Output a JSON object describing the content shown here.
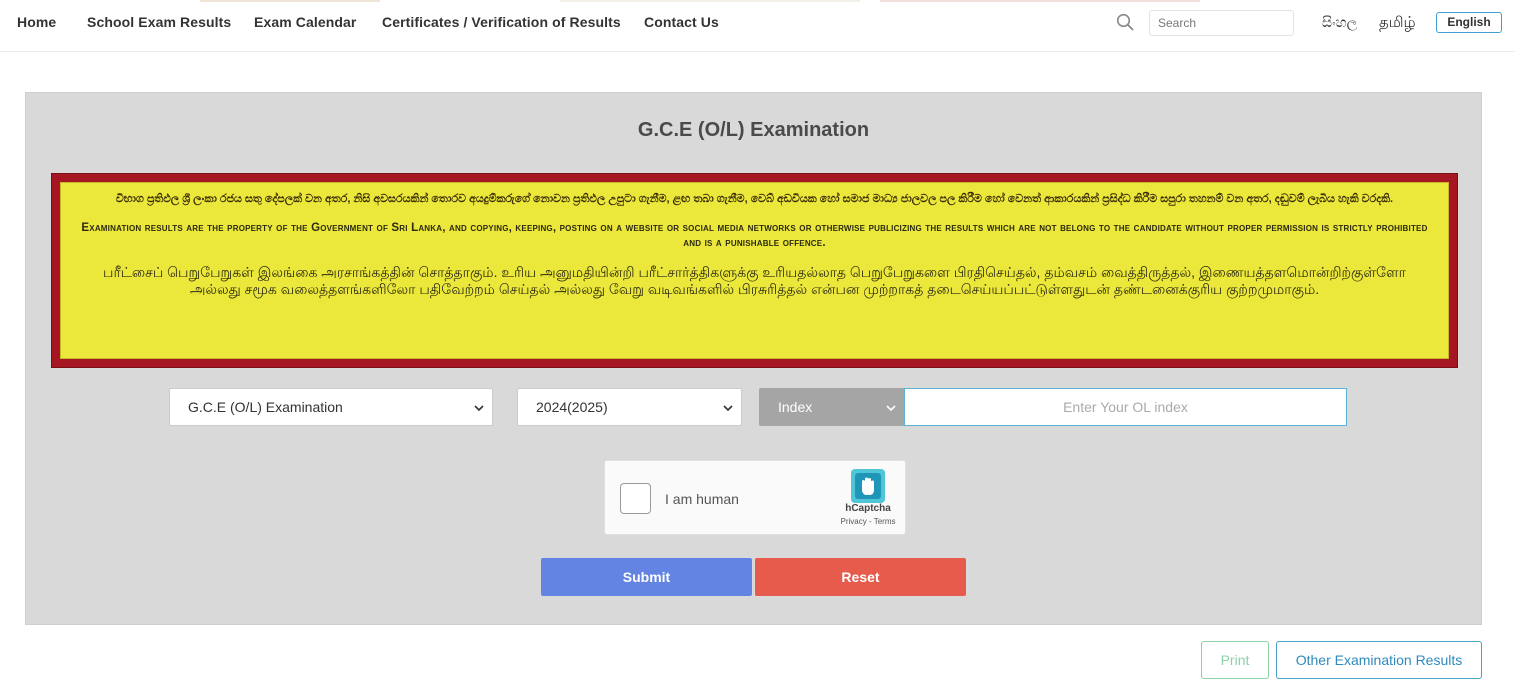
{
  "nav": {
    "items": [
      {
        "label": "Home"
      },
      {
        "label": "School Exam Results"
      },
      {
        "label": "Exam Calendar"
      },
      {
        "label": "Certificates / Verification of Results"
      },
      {
        "label": "Contact Us"
      }
    ],
    "search_placeholder": "Search",
    "languages": {
      "sinhala": "සිංහල",
      "tamil": "தமிழ்",
      "english": "English"
    },
    "icons": {
      "search": "search-icon"
    }
  },
  "panel": {
    "title": "G.C.E (O/L) Examination",
    "notice": {
      "sinhala": "විභාග ප්‍රතිඵල ශ්‍රී ලංකා රජය සතු දේපලක් වන අතර, නිසි අවසරයකින් තොරව අයදුම්කරුගේ නොවන ප්‍රතිඵල උපුටා ගැනීම, ළඟ තබා ගැනීම, වෙබ් අඩවියක හෝ සමාජ මාධ්‍ය ජාලවල පල කිරීම හෝ වෙනත් ආකාරයකින් ප්‍රසිද්ධ කිරීම සපුරා තහනම් වන අතර, දඬුවම් ලැබිය හැකි වරදකි.",
      "english": "Examination results are the property of the Government of Sri Lanka, and copying, keeping, posting on a website or social media networks or otherwise publicizing the results which are not belong to the candidate without proper permission is strictly prohibited and is a punishable offence.",
      "tamil": "பரீட்சைப் பெறுபேறுகள் இலங்கை அரசாங்கத்தின் சொத்தாகும். உரிய அனுமதியின்றி பரீட்சார்த்திகளுக்கு உரியதல்லாத பெறுபேறுகளை பிரதிசெய்தல், தம்வசம் வைத்திருத்தல், இணையத்தளமொன்றிற்குள்ளோ அல்லது சமூக வலைத்தளங்களிலோ பதிவேற்றம் செய்தல் அல்லது வேறு வடிவங்களில் பிரசுரித்தல் என்பன முற்றாகத் தடைசெய்யப்பட்டுள்ளதுடன் தண்டனைக்குரிய குற்றமுமாகும்."
    }
  },
  "form": {
    "exam_select": "G.C.E (O/L) Examination",
    "year_select": "2024(2025)",
    "type_select": "Index",
    "index_placeholder": "Enter Your OL index",
    "captcha": {
      "label": "I am human",
      "brand": "hCaptcha",
      "terms": "Privacy - Terms"
    },
    "submit_label": "Submit",
    "reset_label": "Reset"
  },
  "footer": {
    "print_label": "Print",
    "other_label": "Other Examination Results"
  },
  "colors": {
    "submit": "#6484e3",
    "reset": "#e65b4c",
    "notice_border": "#a51522",
    "notice_fill": "#ebe83b",
    "panel": "#d9d9d9"
  }
}
